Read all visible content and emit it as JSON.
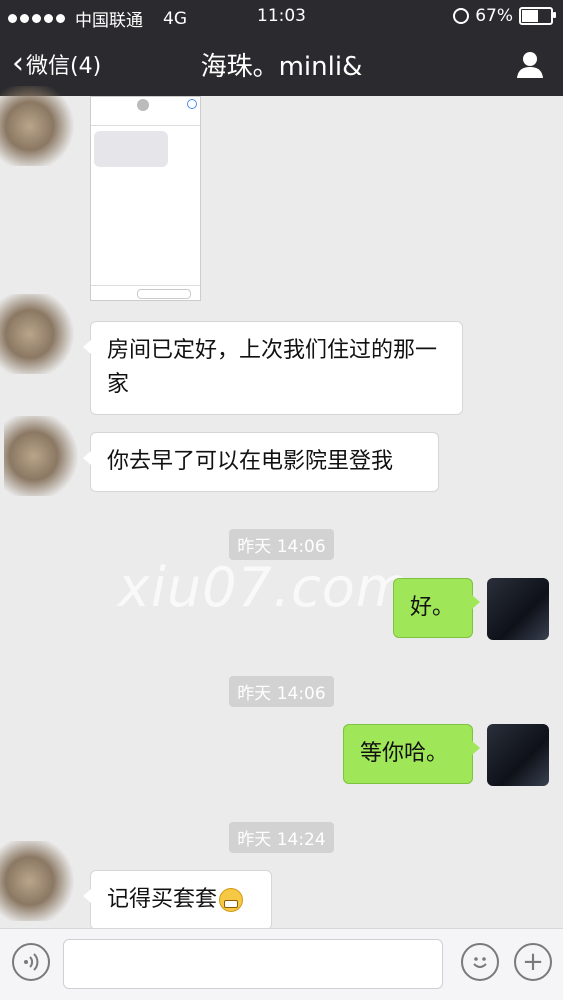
{
  "status": {
    "carrier": "中国联通",
    "network": "4G",
    "time": "11:03",
    "battery_percent": "67%",
    "battery_level": 0.67
  },
  "nav": {
    "back_label": "微信(4)",
    "title": "海珠。minli&",
    "profile_icon": "person-icon"
  },
  "messages": [
    {
      "side": "in",
      "type": "image",
      "content": "sms-screenshot"
    },
    {
      "side": "in",
      "type": "text",
      "text": "房间已定好，上次我们住过的那一家"
    },
    {
      "side": "in",
      "type": "text",
      "text": "你去早了可以在电影院里登我"
    },
    {
      "side": "system",
      "type": "time",
      "text": "昨天 14:06"
    },
    {
      "side": "out",
      "type": "text",
      "text": "好。"
    },
    {
      "side": "system",
      "type": "time",
      "text": "昨天 14:06"
    },
    {
      "side": "out",
      "type": "text",
      "text": "等你哈。"
    },
    {
      "side": "system",
      "type": "time",
      "text": "昨天 14:24"
    },
    {
      "side": "in",
      "type": "text",
      "text": "记得买套套",
      "emoji": "grimacing-emoji"
    }
  ],
  "watermark": "xiu07.com",
  "input": {
    "voice_icon": "voice-icon",
    "emoji_icon": "emoji-icon",
    "plus_icon": "plus-icon"
  },
  "colors": {
    "bar": "#2b2b2f",
    "bg": "#ebebeb",
    "out_bubble": "#9fe658",
    "in_bubble": "#ffffff"
  }
}
